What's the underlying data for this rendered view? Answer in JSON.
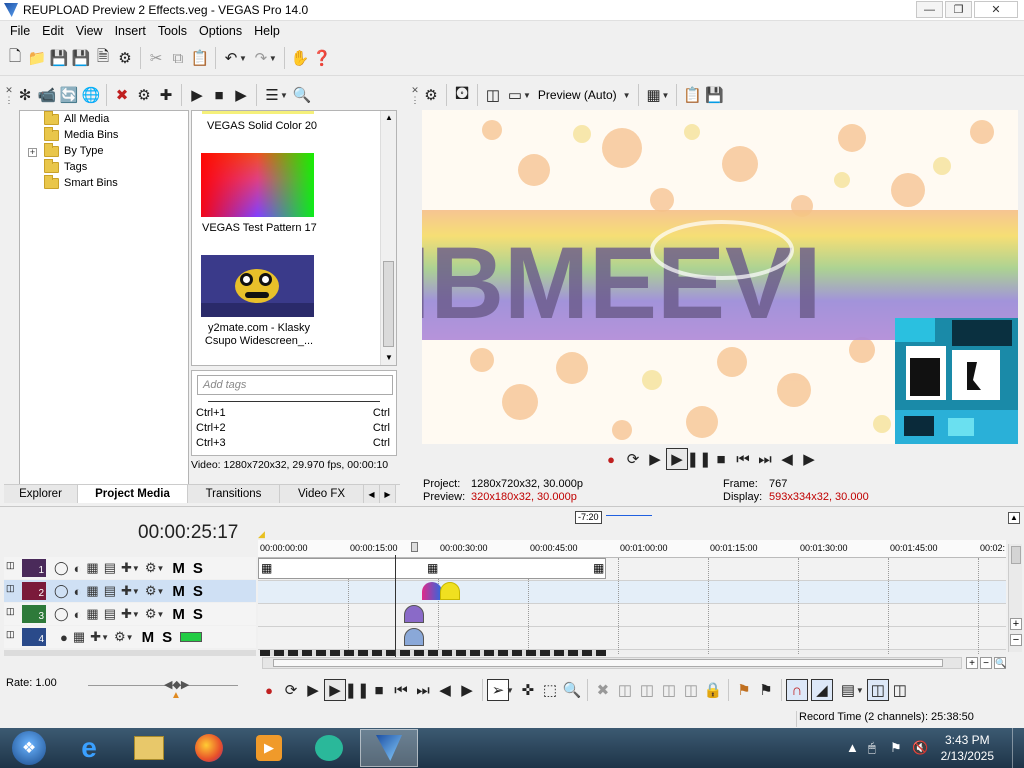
{
  "window": {
    "title": "REUPLOAD Preview 2 Effects.veg - VEGAS Pro 14.0"
  },
  "menu": [
    "File",
    "Edit",
    "View",
    "Insert",
    "Tools",
    "Options",
    "Help"
  ],
  "explorer": {
    "tree": [
      "All Media",
      "Media Bins",
      "By Type",
      "Tags",
      "Smart Bins"
    ],
    "media_items": [
      {
        "label": "VEGAS Solid Color 20"
      },
      {
        "label": "VEGAS Test Pattern 17"
      },
      {
        "label": "y2mate.com - Klasky Csupo Widescreen_..."
      }
    ],
    "add_tags_placeholder": "Add tags",
    "shortcuts": [
      {
        "key": "Ctrl+1",
        "mod": "Ctrl"
      },
      {
        "key": "Ctrl+2",
        "mod": "Ctrl"
      },
      {
        "key": "Ctrl+3",
        "mod": "Ctrl"
      }
    ],
    "video_info": "Video: 1280x720x32, 29.970 fps, 00:00:10",
    "tabs": [
      "Explorer",
      "Project Media",
      "Transitions",
      "Video FX"
    ]
  },
  "preview": {
    "mode": "Preview (Auto)",
    "overlay_text": "IBMEEVI",
    "project_label": "Project:",
    "project_value": "1280x720x32, 30.000p",
    "preview_label": "Preview:",
    "preview_value": "320x180x32, 30.000p",
    "frame_label": "Frame:",
    "frame_value": "767",
    "display_label": "Display:",
    "display_value": "593x334x32, 30.000"
  },
  "timeline": {
    "timecode": "00:00:25:17",
    "marker": "-7:20",
    "ruler": [
      "00:00:00:00",
      "00:00:15:00",
      "00:00:30:00",
      "00:00:45:00",
      "00:01:00:00",
      "00:01:15:00",
      "00:01:30:00",
      "00:01:45:00",
      "00:02:"
    ],
    "tracks": [
      {
        "num": "1",
        "color": "#4a2a5a",
        "m": "M",
        "s": "S"
      },
      {
        "num": "2",
        "color": "#7a1a3a",
        "m": "M",
        "s": "S"
      },
      {
        "num": "3",
        "color": "#2e7a3a",
        "m": "M",
        "s": "S"
      },
      {
        "num": "4",
        "color": "#2a4a8a",
        "m": "M",
        "s": "S"
      }
    ],
    "rate": "Rate: 1.00"
  },
  "status": {
    "record_time": "Record Time (2 channels): 25:38:50"
  },
  "taskbar": {
    "time": "3:43 PM",
    "date": "2/13/2025"
  }
}
